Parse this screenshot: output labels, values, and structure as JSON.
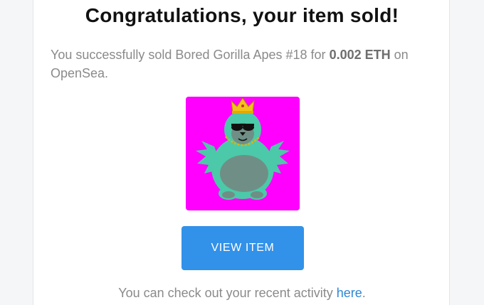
{
  "email": {
    "headline": "Congratulations, your item sold!",
    "message_prefix": "You successfully sold Bored Gorilla Apes #18 for ",
    "sale_amount": "0.002 ETH",
    "message_suffix": " on OpenSea.",
    "nft_image_alt": "Bored Gorilla Apes #18",
    "view_button_label": "VIEW ITEM",
    "footer_text_prefix": "You can check out your recent activity ",
    "footer_link_label": "here",
    "footer_text_suffix": "."
  },
  "colors": {
    "button": "#3291e9",
    "link": "#2f86d6",
    "nft_background": "#ff00ff"
  }
}
